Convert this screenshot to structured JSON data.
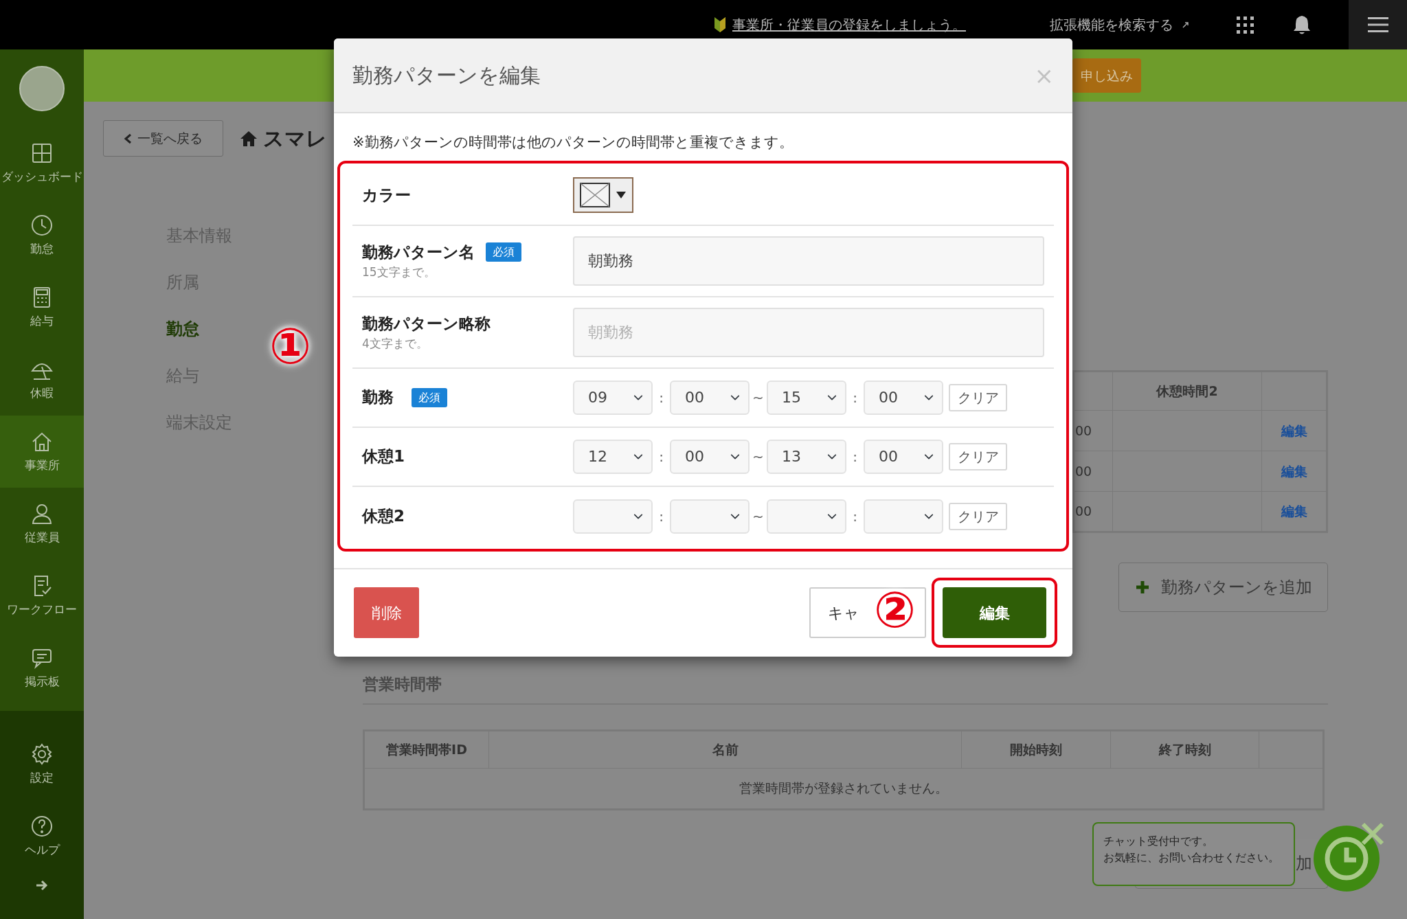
{
  "top_bar": {
    "notice_link": "事業所・従業員の登録をしましょう。",
    "extension_search": "拡張機能を検索する"
  },
  "sidebar": {
    "items": [
      {
        "kind": "dashboard",
        "label": "ダッシュボード",
        "selected": false
      },
      {
        "kind": "clock",
        "label": "勤怠",
        "selected": false
      },
      {
        "kind": "calculator",
        "label": "給与",
        "selected": false
      },
      {
        "kind": "umbrella",
        "label": "休暇",
        "selected": false
      },
      {
        "kind": "home",
        "label": "事業所",
        "selected": true
      },
      {
        "kind": "person",
        "label": "従業員",
        "selected": false
      },
      {
        "kind": "checklist",
        "label": "ワークフロー",
        "selected": false
      },
      {
        "kind": "chat",
        "label": "掲示板",
        "selected": false
      }
    ],
    "bottom_items": [
      {
        "kind": "gear",
        "label": "設定"
      },
      {
        "kind": "help",
        "label": "ヘルプ"
      }
    ]
  },
  "header_bar": {
    "apply_button": "申し込み"
  },
  "page": {
    "back_button": "一覧へ戻る",
    "title": "スマレ",
    "sub_nav": [
      {
        "label": "基本情報",
        "selected": false
      },
      {
        "label": "所属",
        "selected": false
      },
      {
        "label": "勤怠",
        "selected": true
      },
      {
        "label": "給与",
        "selected": false
      },
      {
        "label": "端末設定",
        "selected": false
      }
    ],
    "pattern_table": {
      "break2_header": "休憩時間2",
      "rows": [
        {
          "column_1": "00",
          "action": "編集"
        },
        {
          "column_1": "00",
          "action": "編集"
        },
        {
          "column_1": "00",
          "action": "編集"
        }
      ]
    },
    "add_pattern_button": "勤務パターンを追加",
    "business_hours": {
      "heading": "営業時間帯",
      "columns": [
        "営業時間帯ID",
        "名前",
        "開始時刻",
        "終了時刻"
      ],
      "empty_message": "営業時間帯が登録されていません。"
    },
    "partial_button": "加"
  },
  "modal": {
    "title": "勤務パターンを編集",
    "close": "×",
    "note": "※勤務パターンの時間帯は他のパターンの時間帯と重複できます。",
    "fields": [
      {
        "kind": "color",
        "label": "カラー"
      },
      {
        "kind": "text",
        "label": "勤務パターン名",
        "required_badge": "必須",
        "hint": "15文字まで。",
        "value": "朝勤務"
      },
      {
        "kind": "text",
        "label": "勤務パターン略称",
        "hint": "4文字まで。",
        "placeholder": "朝勤務"
      },
      {
        "kind": "time",
        "label": "勤務",
        "required_badge": "必須",
        "start_hour": "09",
        "start_minute": "00",
        "end_hour": "15",
        "end_minute": "00",
        "separators": [
          ":",
          "~",
          ":"
        ],
        "clear_button": "クリア"
      },
      {
        "kind": "time",
        "label": "休憩1",
        "start_hour": "12",
        "start_minute": "00",
        "end_hour": "13",
        "end_minute": "00",
        "separators": [
          ":",
          "~",
          ":"
        ],
        "clear_button": "クリア"
      },
      {
        "kind": "time",
        "label": "休憩2",
        "separators": [
          ":",
          "~",
          ":"
        ],
        "clear_button": "クリア"
      }
    ],
    "delete_button": "削除",
    "cancel_button": "キャ",
    "submit_button": "編集"
  },
  "annotations": [
    "①",
    "②"
  ],
  "chat": {
    "lines": [
      "チャット受付中です。",
      "お気軽に、お問い合わせください。"
    ]
  }
}
